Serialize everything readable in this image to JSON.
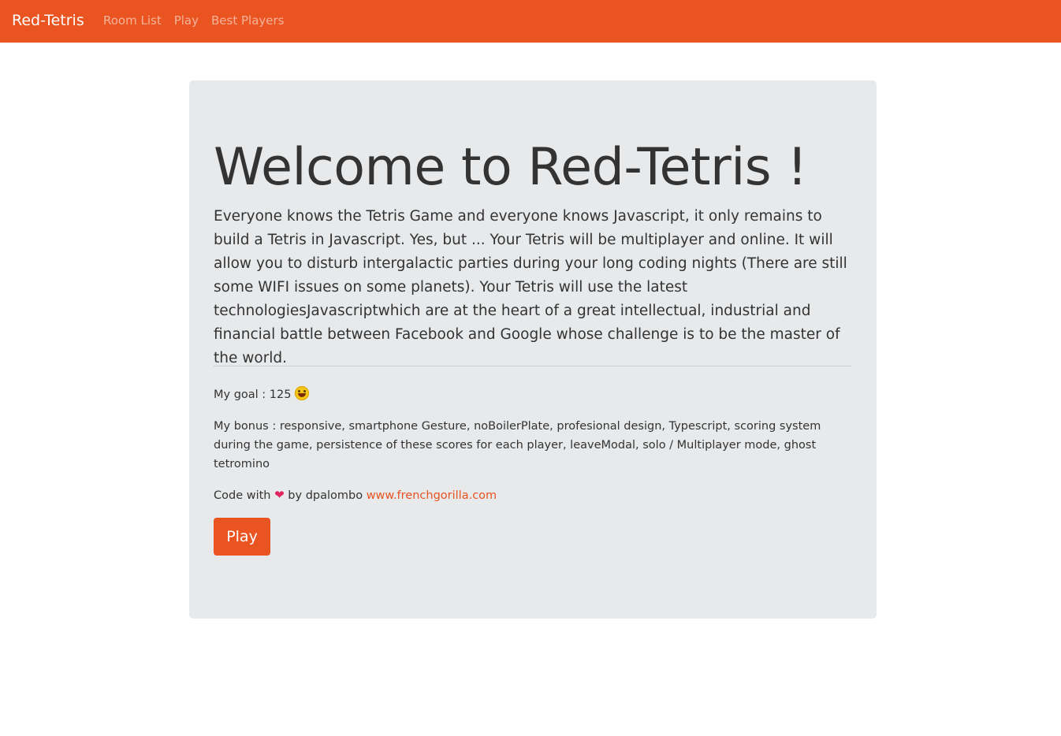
{
  "navbar": {
    "brand": "Red-Tetris",
    "links": [
      "Room List",
      "Play",
      "Best Players"
    ]
  },
  "hero": {
    "title": "Welcome to Red-Tetris !",
    "lead": "Everyone knows the Tetris Game and everyone knows Javascript, it only remains to build a Tetris in Javascript. Yes, but ... Your Tetris will be multiplayer and online. It will allow you to disturb intergalactic parties during your long coding nights (There are still some WIFI issues on some planets). Your Tetris will use the latest technologiesJavascriptwhich are at the heart of a great intellectual, industrial and financial battle between Facebook and Google whose challenge is to be the master of the world."
  },
  "details": {
    "goal_label": "My goal : 125",
    "goal_icon": "grinning-face-icon",
    "bonus_text": "My bonus : responsive, smartphone Gesture, noBoilerPlate, profesional design, Typescript, scoring system during the game, persistence of these scores for each player, leaveModal, solo / Multiplayer mode, ghost tetromino",
    "credit_prefix": "Code with",
    "credit_icon": "heart-icon",
    "credit_by": "by dpalombo",
    "credit_link": "www.frenchgorilla.com"
  },
  "actions": {
    "play_label": "Play"
  },
  "colors": {
    "primary": "#e95420",
    "jumbotron_bg": "#e7e9eb",
    "text": "#333333"
  }
}
